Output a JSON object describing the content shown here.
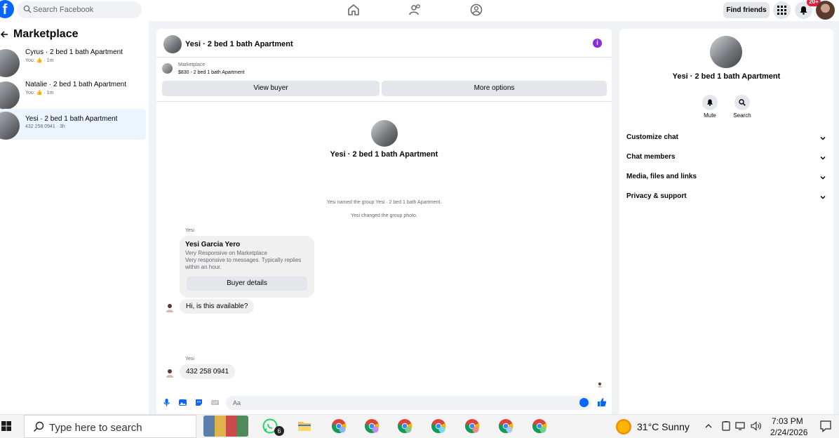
{
  "topbar": {
    "logo": "f",
    "search_placeholder": "Search Facebook",
    "find_friends": "Find friends",
    "notif_badge": "20+",
    "nav_icons": [
      "home-icon",
      "friends-icon",
      "groups-icon"
    ],
    "brand_color": "#0866ff"
  },
  "left": {
    "title": "Marketplace",
    "conversations": [
      {
        "name": "Cyrus · 2 bed 1 bath Apartment",
        "sub": "You: 👍 · 1m"
      },
      {
        "name": "Natalie · 2 bed 1 bath Apartment",
        "sub": "You: 👍 · 1m"
      },
      {
        "name": "Yesi · 2 bed 1 bath Apartment",
        "sub": "432 258 0941 · 3h"
      }
    ]
  },
  "chat": {
    "title": "Yesi · 2 bed 1 bath Apartment",
    "mp_label": "Marketplace",
    "mp_price": "$830 - 2 bed 1 bath Apartment",
    "view_buyer": "View buyer",
    "more_options": "More options",
    "center_title": "Yesi · 2 bed 1 bath Apartment",
    "sys_msg_1": "Yesi named the group Yesi · 2 bed 1 bath Apartment.",
    "sys_msg_2": "Yesi changed the group photo.",
    "sender_1": "Yesi",
    "card_name": "Yesi Garcia Yero",
    "card_line_1": "Very Responsive on Marketplace",
    "card_line_2": "Very responsive to messages. Typically replies within an hour.",
    "card_button": "Buyer details",
    "msg_1": "Hi, is this available?",
    "sender_2": "Yesi",
    "msg_2": "432 258 0941",
    "composer_placeholder": "Aa"
  },
  "right": {
    "title": "Yesi · 2 bed 1 bath Apartment",
    "mute": "Mute",
    "search": "Search",
    "rows": [
      "Customize chat",
      "Chat members",
      "Media, files and links",
      "Privacy & support"
    ]
  },
  "taskbar": {
    "search_placeholder": "Type here to search",
    "whatsapp_badge": "6",
    "weather": "31°C  Sunny",
    "time": "7:03 PM",
    "date": "2/24/2026"
  }
}
